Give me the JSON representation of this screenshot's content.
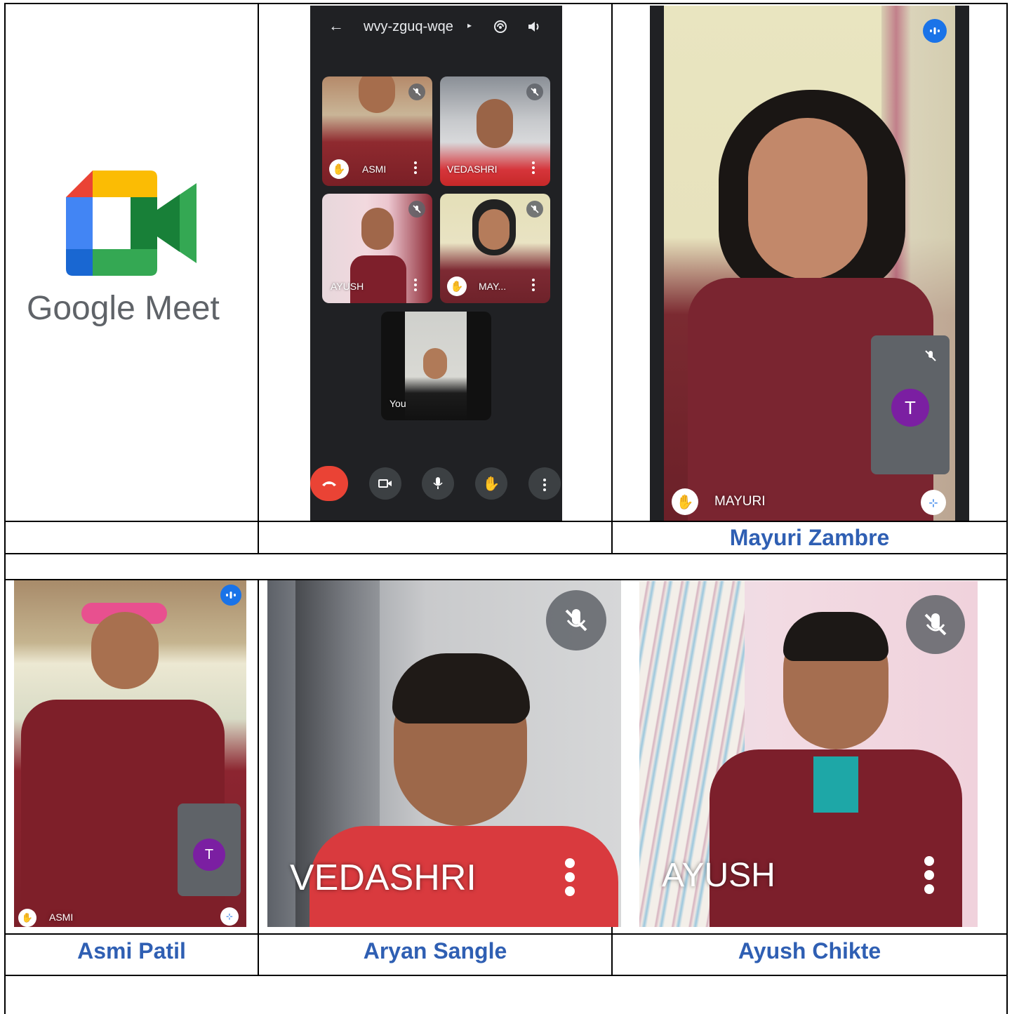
{
  "logo": {
    "wordmark": "Google Meet",
    "colors": {
      "red": "#ea4335",
      "yellow": "#fbbc04",
      "blue": "#4285f4",
      "green": "#34a853",
      "darkgreen": "#188038"
    }
  },
  "phone": {
    "meeting_code": "wvy-zguq-wqe",
    "tiles": [
      {
        "name": "ASMI"
      },
      {
        "name": "VEDASHRI"
      },
      {
        "name": "AYUSH"
      },
      {
        "name": "MAY..."
      },
      {
        "name": "You"
      }
    ],
    "controls": [
      "end-call",
      "camera",
      "microphone",
      "raise-hand",
      "more"
    ]
  },
  "mayuri_view": {
    "name": "MAYURI",
    "avatar_letter": "T"
  },
  "asmi_view": {
    "name": "ASMI",
    "avatar_letter": "T"
  },
  "vedashri_view": {
    "name": "VEDASHRI"
  },
  "ayush_view": {
    "name": "AYUSH"
  },
  "captions": {
    "row1_col1": "",
    "row1_col2": "",
    "row1_col3": "Mayuri Zambre",
    "row2_col1": "Asmi Patil",
    "row2_col2": "Aryan Sangle",
    "row2_col3": "Ayush Chikte"
  }
}
